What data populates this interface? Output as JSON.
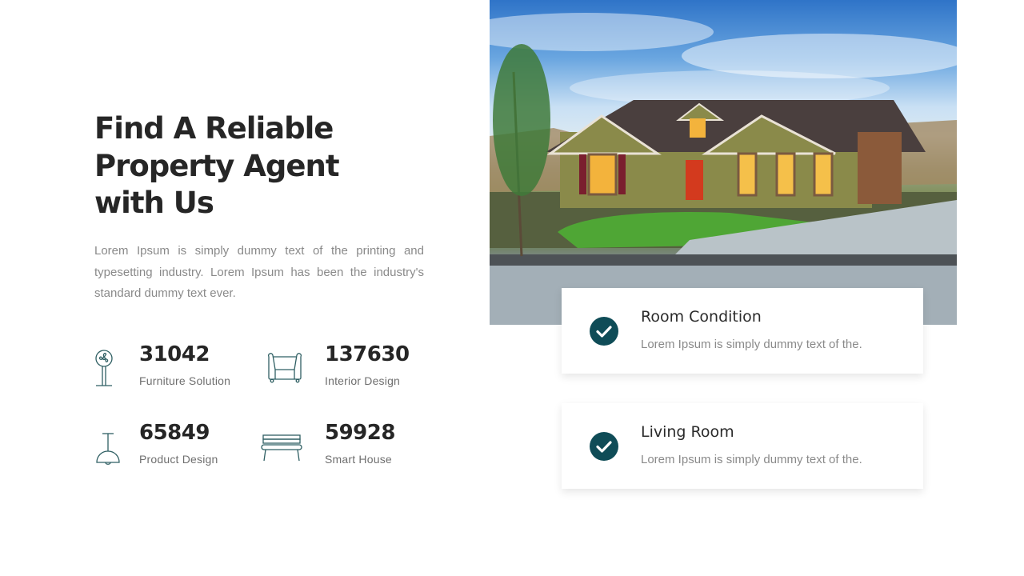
{
  "headline": {
    "line1": "Find A Reliable",
    "line2": "Property Agent",
    "line3": "with Us"
  },
  "intro": "Lorem Ipsum is simply dummy text of the printing and typesetting industry.  Lorem Ipsum has been the industry's standard dummy text ever.",
  "stats": [
    {
      "value": "31042",
      "label": "Furniture Solution",
      "icon": "standing-fan-icon"
    },
    {
      "value": "137630",
      "label": "Interior Design",
      "icon": "armchair-icon"
    },
    {
      "value": "65849",
      "label": "Product Design",
      "icon": "pendant-lamp-icon"
    },
    {
      "value": "59928",
      "label": "Smart House",
      "icon": "bench-icon"
    }
  ],
  "hero_image": {
    "alt": "Suburban house at dusk with lawn and wet driveway"
  },
  "features": [
    {
      "title": "Room Condition",
      "description": "Lorem Ipsum is simply dummy text of the.",
      "icon": "check-circle-icon"
    },
    {
      "title": "Living Room",
      "description": "Lorem Ipsum is simply dummy text of the.",
      "icon": "check-circle-icon"
    }
  ],
  "colors": {
    "accent": "#0f4c57",
    "icon_stroke": "#2f5f63",
    "heading": "#262626",
    "body_text": "#8a8a8a"
  }
}
